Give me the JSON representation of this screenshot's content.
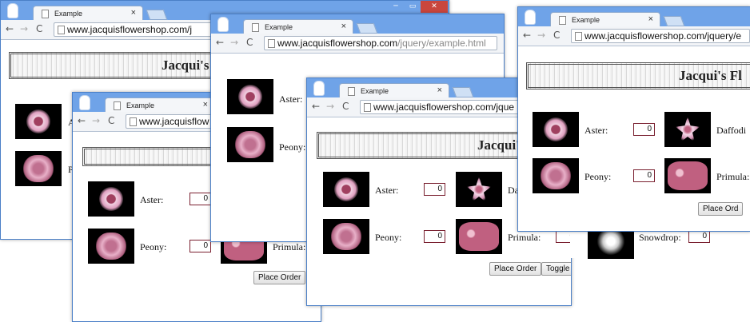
{
  "tab_title": "Example",
  "url_host": "www.jacquisflowershop.com",
  "url_path": "/jquery/example.html",
  "url_full": "www.jacquisflowershop.com/jquery/example.html",
  "url_partial_a": "www.jacquisflowershop.com/j",
  "url_partial_b": "www.jacquisflowershop.com/jquery/e",
  "url_partial_c": "www.jacquisflow",
  "url_partial_d": "www.jacquisflowershop.com/jque",
  "banner_title": "Jacqui's",
  "banner_title_long": "Jacqui's Fl",
  "flowers": {
    "aster": "Aster:",
    "peony": "Peony:",
    "primula": "Primula:",
    "daffodil": "Daffodil:",
    "snowdrop": "Snowdrop:",
    "aster_cut": "A",
    "peony_cut": "P",
    "daffodil_cut": "Da",
    "daffodil_cut2": "Daffodi",
    "primula_cut": "Primula:"
  },
  "qty_value": "0",
  "place_order_label": "Place Order",
  "place_order_cut": "Place Ord",
  "toggle_label": "Toggle",
  "window_controls": {
    "minimize": "─",
    "maximize": "▭",
    "close": "✕"
  },
  "icons": {
    "back": "←",
    "forward": "→",
    "reload": "C",
    "close_tab": "×"
  }
}
